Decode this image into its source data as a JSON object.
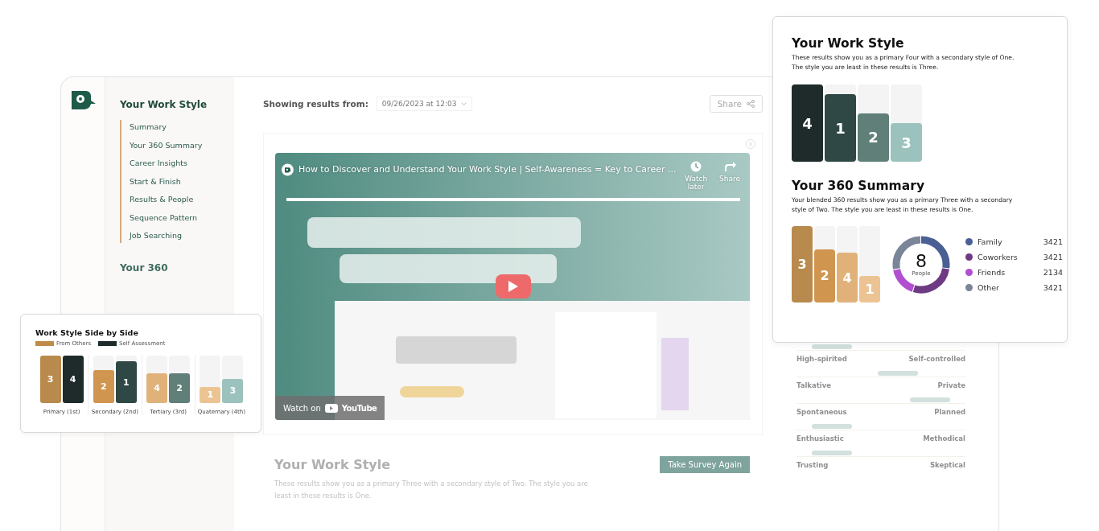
{
  "app": {
    "sidebar": {
      "heading": "Your Work Style",
      "items": [
        {
          "label": "Summary"
        },
        {
          "label": "Your 360 Summary"
        },
        {
          "label": "Career Insights"
        },
        {
          "label": "Start & Finish"
        },
        {
          "label": "Results & People"
        },
        {
          "label": "Sequence Pattern"
        },
        {
          "label": "Job Searching"
        }
      ],
      "section_2": "Your 360"
    },
    "header": {
      "label": "Showing results from:",
      "date": "09/26/2023 at 12:03",
      "share_button": "Share"
    },
    "video": {
      "title": "How to Discover and Understand Your Work Style | Self-Awareness = Key to Career ...",
      "watch_later": "Watch later",
      "share": "Share",
      "watch_on": "Watch on",
      "brand": "YouTube"
    },
    "work_style": {
      "title": "Your Work Style",
      "description": "These results show you as a primary Three with a secondary style of Two. The style you are least in these results is One.",
      "button": "Take Survey Again"
    },
    "traits": [
      {
        "left": "High-spirited",
        "right": "Self-controlled",
        "level": 0.12
      },
      {
        "left": "Talkative",
        "right": "Private",
        "level": 0.63
      },
      {
        "left": "Spontaneous",
        "right": "Planned",
        "level": 0.88
      },
      {
        "left": "Enthusiastic",
        "right": "Methodical",
        "level": 0.12
      },
      {
        "left": "Trusting",
        "right": "Skeptical",
        "level": 0.12
      }
    ]
  },
  "side_by_side": {
    "title": "Work Style Side by Side",
    "legend": [
      {
        "label": "From Others",
        "color": "#c08a48"
      },
      {
        "label": "Self Assessment",
        "color": "#1f2b2b"
      }
    ],
    "groups": [
      {
        "label": "Primary (1st)",
        "bars": [
          {
            "label": "3",
            "level": 1,
            "color": "#b98a4e"
          },
          {
            "label": "4",
            "level": 1,
            "color": "#1f2b2b"
          }
        ]
      },
      {
        "label": "Secondary (2nd)",
        "bars": [
          {
            "label": "2",
            "level": 0.7,
            "color": "#d0954f"
          },
          {
            "label": "1",
            "level": 0.88,
            "color": "#2f4845"
          }
        ]
      },
      {
        "label": "Tertiary (3rd)",
        "bars": [
          {
            "label": "4",
            "level": 0.63,
            "color": "#e0b27a"
          },
          {
            "label": "2",
            "level": 0.63,
            "color": "#5f7f78"
          }
        ]
      },
      {
        "label": "Quaternary (4th)",
        "bars": [
          {
            "label": "1",
            "level": 0.34,
            "color": "#ecc493"
          },
          {
            "label": "3",
            "level": 0.51,
            "color": "#9cc2bd"
          }
        ]
      }
    ]
  },
  "results_card": {
    "work_style": {
      "title": "Your Work Style",
      "description": "These results show you as a primary Four with a secondary style of One. The style you are least in these results is Three.",
      "bars": [
        {
          "label": "4",
          "level": 1,
          "color": "#1f2b2b"
        },
        {
          "label": "1",
          "level": 0.87,
          "color": "#2f4845"
        },
        {
          "label": "2",
          "level": 0.63,
          "color": "#5f7f78"
        },
        {
          "label": "3",
          "level": 0.5,
          "color": "#9cc2bd"
        }
      ]
    },
    "summary_360": {
      "title": "Your 360 Summary",
      "description": "Your blended 360 results show you as a primary Three with a secondary style of Two. The style you are least in these results is One.",
      "bars": [
        {
          "label": "3",
          "level": 1,
          "color": "#b98a4e"
        },
        {
          "label": "2",
          "level": 0.7,
          "color": "#d0954f"
        },
        {
          "label": "4",
          "level": 0.65,
          "color": "#e0b27a"
        },
        {
          "label": "1",
          "level": 0.35,
          "color": "#ecc493"
        }
      ],
      "donut": {
        "count": "8",
        "unit": "People"
      },
      "legend": [
        {
          "label": "Family",
          "value": "3421",
          "color": "#4a5f93"
        },
        {
          "label": "Coworkers",
          "value": "3421",
          "color": "#6e3a83"
        },
        {
          "label": "Friends",
          "value": "2134",
          "color": "#b04fcf"
        },
        {
          "label": "Other",
          "value": "3421",
          "color": "#7a8599"
        }
      ]
    }
  }
}
